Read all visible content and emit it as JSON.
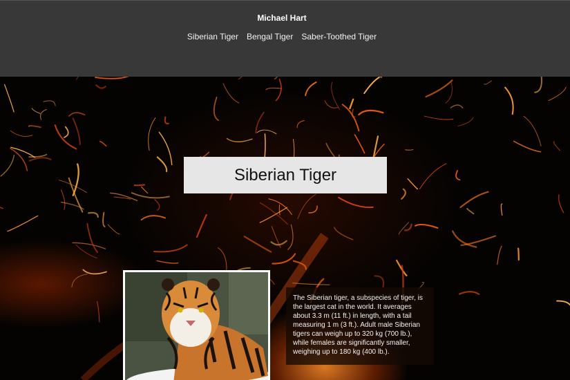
{
  "header": {
    "brand": "Michael Hart",
    "nav": [
      "Siberian Tiger",
      "Bengal Tiger",
      "Saber-Toothed Tiger"
    ]
  },
  "hero": {
    "title": "Siberian Tiger",
    "description": "The Siberian tiger, a subspecies of tiger, is the largest cat in the world. It averages about 3.3 m (11 ft.) in length, with a tail measuring 1 m (3 ft.). Adult male Siberian tigers can weigh up to 320 kg (700 lb.), while females are significantly smaller, weighing up to 180 kg (400 lb.)."
  },
  "colors": {
    "header_bg": "#383838",
    "title_box_bg": "#e6e6e6",
    "spark": "#ff7a1a"
  }
}
